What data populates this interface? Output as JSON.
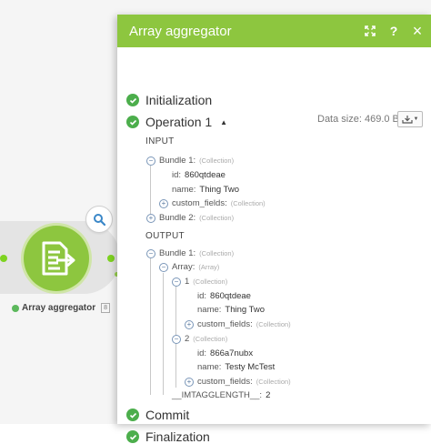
{
  "module": {
    "label": "Array aggregator",
    "badge": "8",
    "search_icon": "search-icon",
    "module_icon": "aggregator-icon"
  },
  "panel": {
    "title": "Array aggregator",
    "buttons": {
      "expand_icon": "expand-icon",
      "help": "?",
      "close": "×"
    },
    "data_size": "Data size: 469.0 B",
    "download_icon": "download-icon",
    "stages": {
      "initialization": "Initialization",
      "operation": "Operation 1",
      "commit": "Commit",
      "finalization": "Finalization"
    },
    "input": {
      "title": "INPUT",
      "bundle1": {
        "label": "Bundle 1:",
        "type": "(Collection)"
      },
      "id": {
        "key": "id:",
        "value": "860qtdeae"
      },
      "name": {
        "key": "name:",
        "value": "Thing Two"
      },
      "custom_fields": {
        "label": "custom_fields:",
        "type": "(Collection)"
      },
      "bundle2": {
        "label": "Bundle 2:",
        "type": "(Collection)"
      }
    },
    "output": {
      "title": "OUTPUT",
      "bundle1": {
        "label": "Bundle 1:",
        "type": "(Collection)"
      },
      "array": {
        "label": "Array:",
        "type": "(Array)"
      },
      "item1": {
        "label": "1",
        "type": "(Collection)"
      },
      "item1_id": {
        "key": "id:",
        "value": "860qtdeae"
      },
      "item1_name": {
        "key": "name:",
        "value": "Thing Two"
      },
      "item1_custom": {
        "label": "custom_fields:",
        "type": "(Collection)"
      },
      "item2": {
        "label": "2",
        "type": "(Collection)"
      },
      "item2_id": {
        "key": "id:",
        "value": "866a7nubx"
      },
      "item2_name": {
        "key": "name:",
        "value": "Testy McTest"
      },
      "item2_custom": {
        "label": "custom_fields:",
        "type": "(Collection)"
      },
      "length": {
        "key": "__IMTAGGLENGTH__:",
        "value": "2"
      }
    }
  },
  "colors": {
    "accent": "#8dc63f",
    "success": "#4cae4c"
  }
}
